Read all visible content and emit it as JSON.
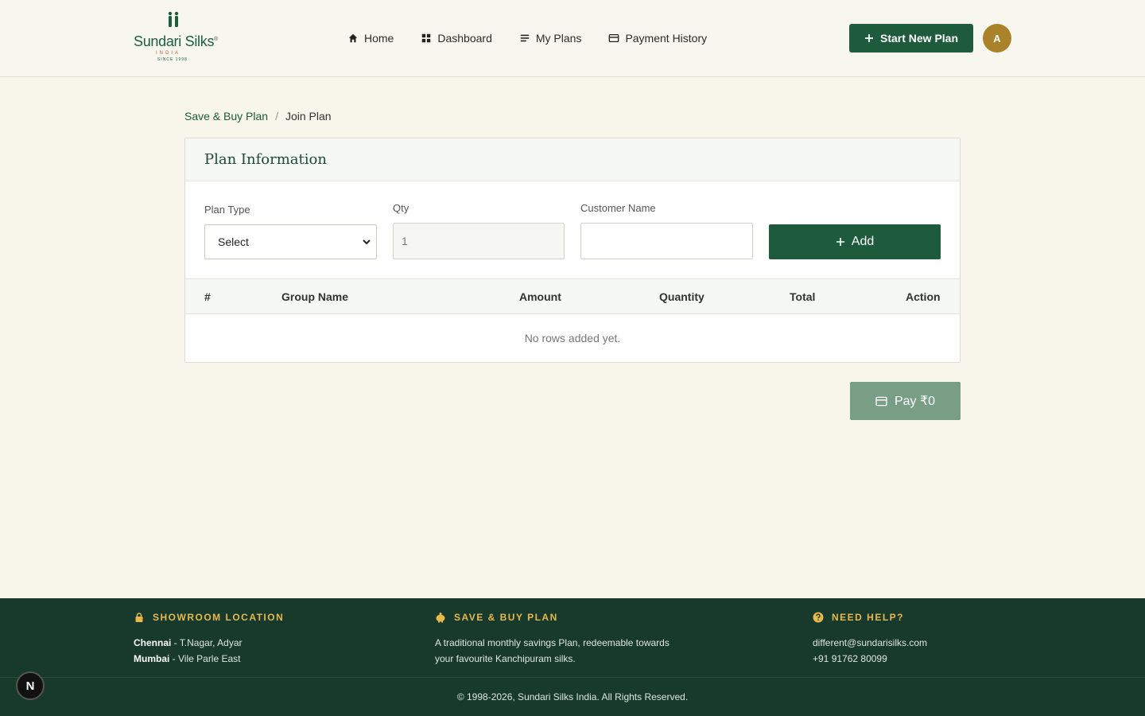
{
  "brand": {
    "name": "Sundari Silks",
    "registered": "®",
    "tagline": "INDIA",
    "since": "SINCE 1998"
  },
  "nav": {
    "items": [
      {
        "label": "Home",
        "icon": "home-icon"
      },
      {
        "label": "Dashboard",
        "icon": "grid-icon"
      },
      {
        "label": "My Plans",
        "icon": "list-icon"
      },
      {
        "label": "Payment History",
        "icon": "card-icon"
      }
    ],
    "start_button": "Start New Plan",
    "avatar_initial": "A"
  },
  "breadcrumb": {
    "parent": "Save & Buy Plan",
    "separator": "/",
    "current": "Join Plan"
  },
  "card": {
    "title": "Plan Information",
    "plan_type": {
      "label": "Plan Type",
      "value": "Select"
    },
    "qty": {
      "label": "Qty",
      "value": "1"
    },
    "customer_name": {
      "label": "Customer Name",
      "value": ""
    },
    "add_button": "Add"
  },
  "table": {
    "columns": [
      "#",
      "Group Name",
      "Amount",
      "Quantity",
      "Total",
      "Action"
    ],
    "empty_message": "No rows added yet."
  },
  "pay_button": "Pay ₹0",
  "footer": {
    "showroom": {
      "heading": "SHOWROOM LOCATION",
      "line1_city": "Chennai",
      "line1_area": " - T.Nagar, Adyar",
      "line2_city": "Mumbai",
      "line2_area": " - Vile Parle East"
    },
    "save_buy": {
      "heading": "SAVE & BUY PLAN",
      "line1": "A traditional monthly savings Plan, redeemable towards",
      "line2": "your favourite Kanchipuram silks."
    },
    "help": {
      "heading": "NEED HELP?",
      "email": "different@sundarisilks.com",
      "phone": "+91 91762 80099"
    },
    "copyright": "© 1998-2026, Sundari Silks India. All Rights Reserved."
  },
  "dev_badge": "N",
  "colors": {
    "primary": "#1e5a3c",
    "gold": "#a9822a",
    "footer_bg": "#173a2c",
    "accent": "#e8b84a"
  }
}
